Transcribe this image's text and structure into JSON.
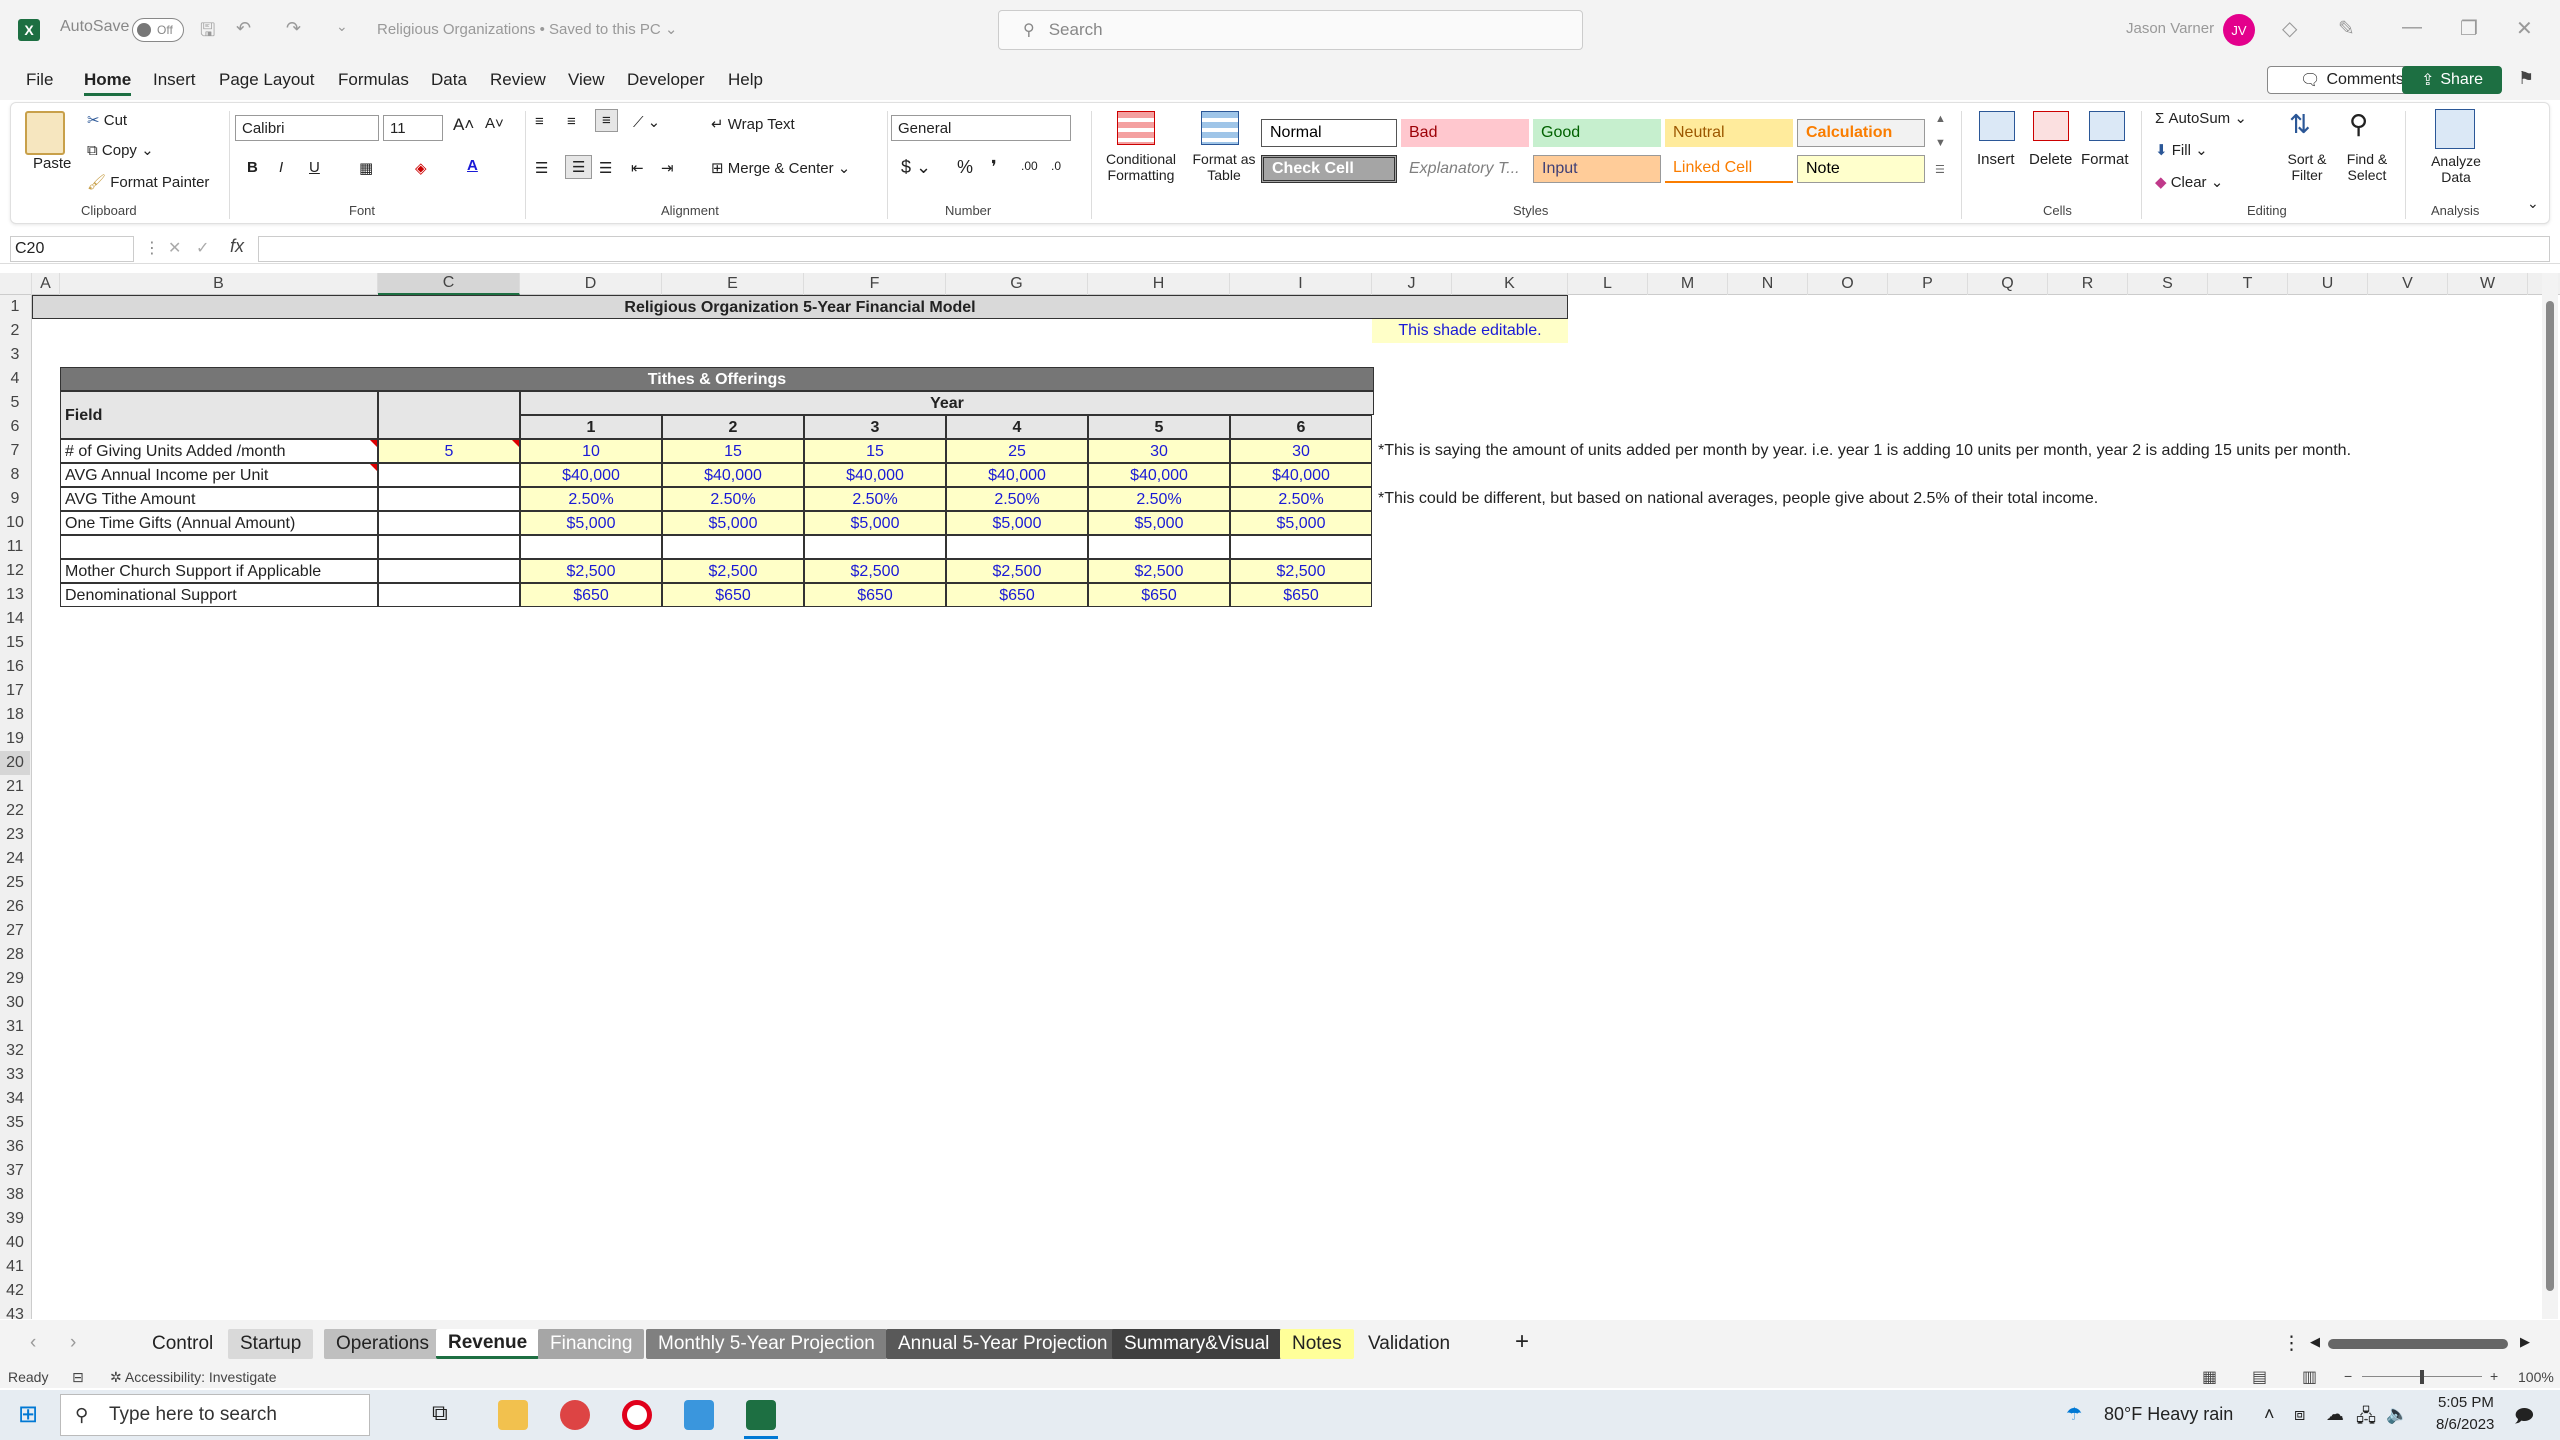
{
  "titlebar": {
    "autosave": "AutoSave",
    "toggle": "Off",
    "doc_title": "Religious Organizations • Saved to this PC ⌄",
    "search_placeholder": "Search",
    "user": "Jason Varner",
    "avatar": "JV"
  },
  "menu": {
    "items": [
      "File",
      "Home",
      "Insert",
      "Page Layout",
      "Formulas",
      "Data",
      "Review",
      "View",
      "Developer",
      "Help"
    ],
    "active": "Home",
    "comments": "Comments",
    "share": "Share"
  },
  "ribbon": {
    "clipboard": {
      "paste": "Paste",
      "cut": "Cut",
      "copy": "Copy",
      "format_painter": "Format Painter",
      "label": "Clipboard"
    },
    "font": {
      "name": "Calibri",
      "size": "11",
      "label": "Font"
    },
    "alignment": {
      "wrap": "Wrap Text",
      "merge": "Merge & Center",
      "label": "Alignment"
    },
    "number": {
      "format": "General",
      "label": "Number"
    },
    "styles": {
      "conditional": "Conditional Formatting",
      "format_table": "Format as Table",
      "label": "Styles",
      "cells": [
        {
          "name": "Normal",
          "bg": "#ffffff",
          "fg": "#000000"
        },
        {
          "name": "Bad",
          "bg": "#ffc7ce",
          "fg": "#9c0006"
        },
        {
          "name": "Good",
          "bg": "#c6efce",
          "fg": "#006100"
        },
        {
          "name": "Neutral",
          "bg": "#ffeb9c",
          "fg": "#9c5700"
        },
        {
          "name": "Calculation",
          "bg": "#f2f2f2",
          "fg": "#fa7d00"
        },
        {
          "name": "Check Cell",
          "bg": "#a5a5a5",
          "fg": "#ffffff"
        },
        {
          "name": "Explanatory T...",
          "bg": "#ffffff",
          "fg": "#7f7f7f"
        },
        {
          "name": "Input",
          "bg": "#ffcc99",
          "fg": "#3f3f76"
        },
        {
          "name": "Linked Cell",
          "bg": "#ffffff",
          "fg": "#fa7d00"
        },
        {
          "name": "Note",
          "bg": "#ffffcc",
          "fg": "#000000"
        }
      ]
    },
    "cells": {
      "insert": "Insert",
      "delete": "Delete",
      "format": "Format",
      "label": "Cells"
    },
    "editing": {
      "autosum": "AutoSum",
      "fill": "Fill",
      "clear": "Clear",
      "sort": "Sort & Filter",
      "find": "Find & Select",
      "label": "Editing"
    },
    "analysis": {
      "analyze": "Analyze Data",
      "label": "Analysis"
    }
  },
  "formula_bar": {
    "name_box": "C20",
    "fx": "fx",
    "formula": ""
  },
  "columns": [
    "A",
    "B",
    "C",
    "D",
    "E",
    "F",
    "G",
    "H",
    "I",
    "J",
    "K",
    "L",
    "M",
    "N",
    "O",
    "P",
    "Q",
    "R",
    "S",
    "T",
    "U",
    "V",
    "W"
  ],
  "rows": [
    "1",
    "2",
    "3",
    "4",
    "5",
    "6",
    "7",
    "8",
    "9",
    "10",
    "11",
    "12",
    "13",
    "14",
    "15",
    "16",
    "17",
    "18",
    "19",
    "20",
    "21",
    "22",
    "23",
    "24",
    "25",
    "26",
    "27",
    "28",
    "29",
    "30",
    "31",
    "32",
    "33",
    "34",
    "35",
    "36",
    "37",
    "38",
    "39",
    "40",
    "41",
    "42",
    "43"
  ],
  "sheet": {
    "title": "Religious Organization 5-Year Financial Model",
    "editable_note": "This shade editable.",
    "section": "Tithes & Offerings",
    "field_hdr": "Field",
    "year_hdr": "Year",
    "years": [
      "1",
      "2",
      "3",
      "4",
      "5",
      "6"
    ],
    "rows": [
      {
        "label": "# of Giving Units Added /month",
        "c": "5",
        "vals": [
          "10",
          "15",
          "15",
          "25",
          "30",
          "30"
        ]
      },
      {
        "label": "AVG Annual Income per Unit",
        "c": "",
        "vals": [
          "$40,000",
          "$40,000",
          "$40,000",
          "$40,000",
          "$40,000",
          "$40,000"
        ]
      },
      {
        "label": "AVG Tithe Amount",
        "c": "",
        "vals": [
          "2.50%",
          "2.50%",
          "2.50%",
          "2.50%",
          "2.50%",
          "2.50%"
        ]
      },
      {
        "label": "One Time Gifts (Annual Amount)",
        "c": "",
        "vals": [
          "$5,000",
          "$5,000",
          "$5,000",
          "$5,000",
          "$5,000",
          "$5,000"
        ]
      },
      {
        "label": "",
        "c": "",
        "vals": [
          "",
          "",
          "",
          "",
          "",
          ""
        ]
      },
      {
        "label": "Mother Church Support if Applicable",
        "c": "",
        "vals": [
          "$2,500",
          "$2,500",
          "$2,500",
          "$2,500",
          "$2,500",
          "$2,500"
        ]
      },
      {
        "label": "Denominational Support",
        "c": "",
        "vals": [
          "$650",
          "$650",
          "$650",
          "$650",
          "$650",
          "$650"
        ]
      }
    ],
    "note1": "*This is saying the amount of units added per month by year. i.e. year 1 is adding 10 units per month, year 2 is adding 15 units per month.",
    "note2": "*This could be different, but based on national averages, people give about 2.5% of their total income."
  },
  "tabs": [
    {
      "name": "Control",
      "bg": "transparent",
      "fg": "#222"
    },
    {
      "name": "Startup",
      "bg": "#d9d9d9",
      "fg": "#222"
    },
    {
      "name": "Operations",
      "bg": "#bfbfbf",
      "fg": "#222"
    },
    {
      "name": "Revenue",
      "bg": "#ffffff",
      "fg": "#222"
    },
    {
      "name": "Financing",
      "bg": "#a6a6a6",
      "fg": "#fff"
    },
    {
      "name": "Monthly 5-Year Projection",
      "bg": "#808080",
      "fg": "#fff"
    },
    {
      "name": "Annual 5-Year Projection",
      "bg": "#595959",
      "fg": "#fff"
    },
    {
      "name": "Summary&Visual",
      "bg": "#404040",
      "fg": "#fff"
    },
    {
      "name": "Notes",
      "bg": "#ffff99",
      "fg": "#222"
    },
    {
      "name": "Validation",
      "bg": "transparent",
      "fg": "#222"
    }
  ],
  "status": {
    "ready": "Ready",
    "accessibility": "Accessibility: Investigate",
    "zoom": "100%"
  },
  "taskbar": {
    "search": "Type here to search",
    "weather": "80°F  Heavy rain",
    "time": "5:05 PM",
    "date": "8/6/2023"
  }
}
